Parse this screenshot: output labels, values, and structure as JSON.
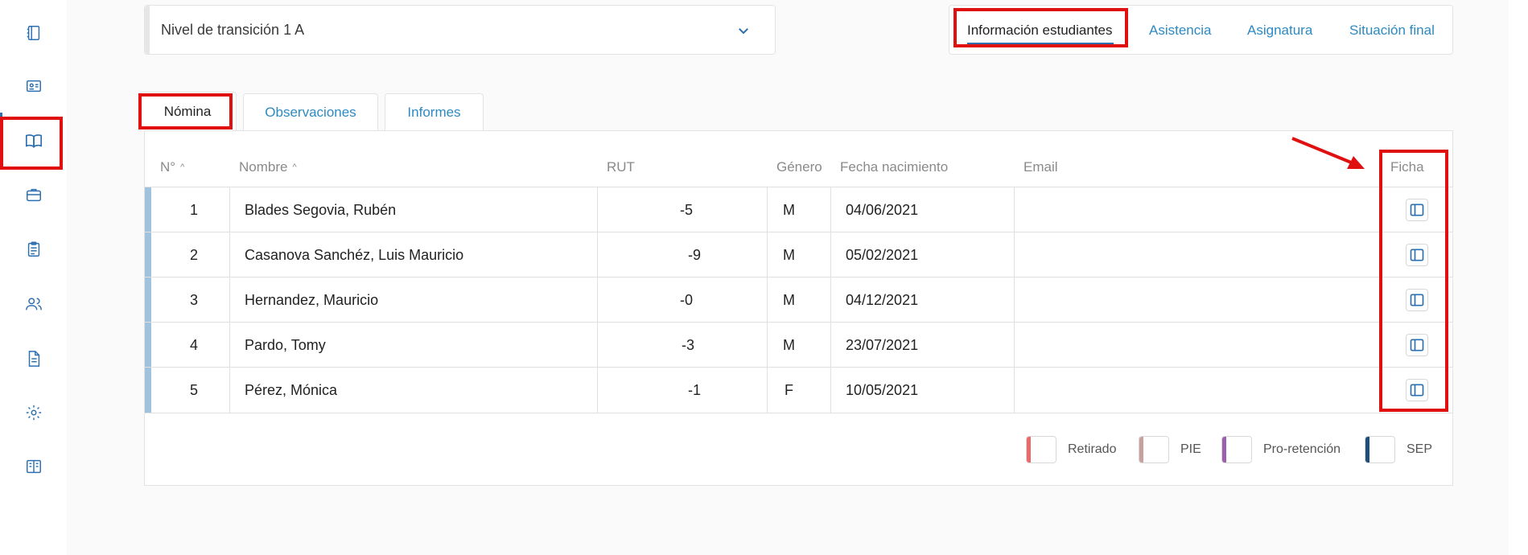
{
  "selector": {
    "value": "Nivel de transición 1 A"
  },
  "topnav": [
    {
      "label": "Información estudiantes"
    },
    {
      "label": "Asistencia"
    },
    {
      "label": "Asignatura"
    },
    {
      "label": "Situación final"
    }
  ],
  "tabs": [
    {
      "label": "Nómina"
    },
    {
      "label": "Observaciones"
    },
    {
      "label": "Informes"
    }
  ],
  "table": {
    "headers": [
      "N°",
      "Nombre",
      "RUT",
      "Género",
      "Fecha nacimiento",
      "Email",
      "Ficha"
    ],
    "rows": [
      {
        "n": "1",
        "nombre": "Blades Segovia, Rubén",
        "rut": "-5",
        "genero": "M",
        "fecha": "04/06/2021",
        "email": ""
      },
      {
        "n": "2",
        "nombre": "Casanova Sanchéz, Luis Mauricio",
        "rut": "-9",
        "genero": "M",
        "fecha": "05/02/2021",
        "email": ""
      },
      {
        "n": "3",
        "nombre": "Hernandez, Mauricio",
        "rut": "-0",
        "genero": "M",
        "fecha": "04/12/2021",
        "email": ""
      },
      {
        "n": "4",
        "nombre": "Pardo, Tomy",
        "rut": "-3",
        "genero": "M",
        "fecha": "23/07/2021",
        "email": ""
      },
      {
        "n": "5",
        "nombre": "Pérez, Mónica",
        "rut": "-1",
        "genero": "F",
        "fecha": "10/05/2021",
        "email": ""
      }
    ]
  },
  "legend": [
    {
      "label": "Retirado",
      "color": "#e86a6a"
    },
    {
      "label": "PIE",
      "color": "#c9a0a0"
    },
    {
      "label": "Pro-retención",
      "color": "#9b5fae"
    },
    {
      "label": "SEP",
      "color": "#1f4f78"
    }
  ],
  "colors": {
    "accent": "#2e6fb0",
    "link": "#2e8ac2",
    "highlight": "#e01010",
    "row_accent": "#9fc3dd"
  },
  "icons": [
    "notebook-icon",
    "id-card-icon",
    "book-open-icon",
    "briefcase-icon",
    "clipboard-icon",
    "users-icon",
    "document-icon",
    "gear-icon",
    "book-icon"
  ]
}
